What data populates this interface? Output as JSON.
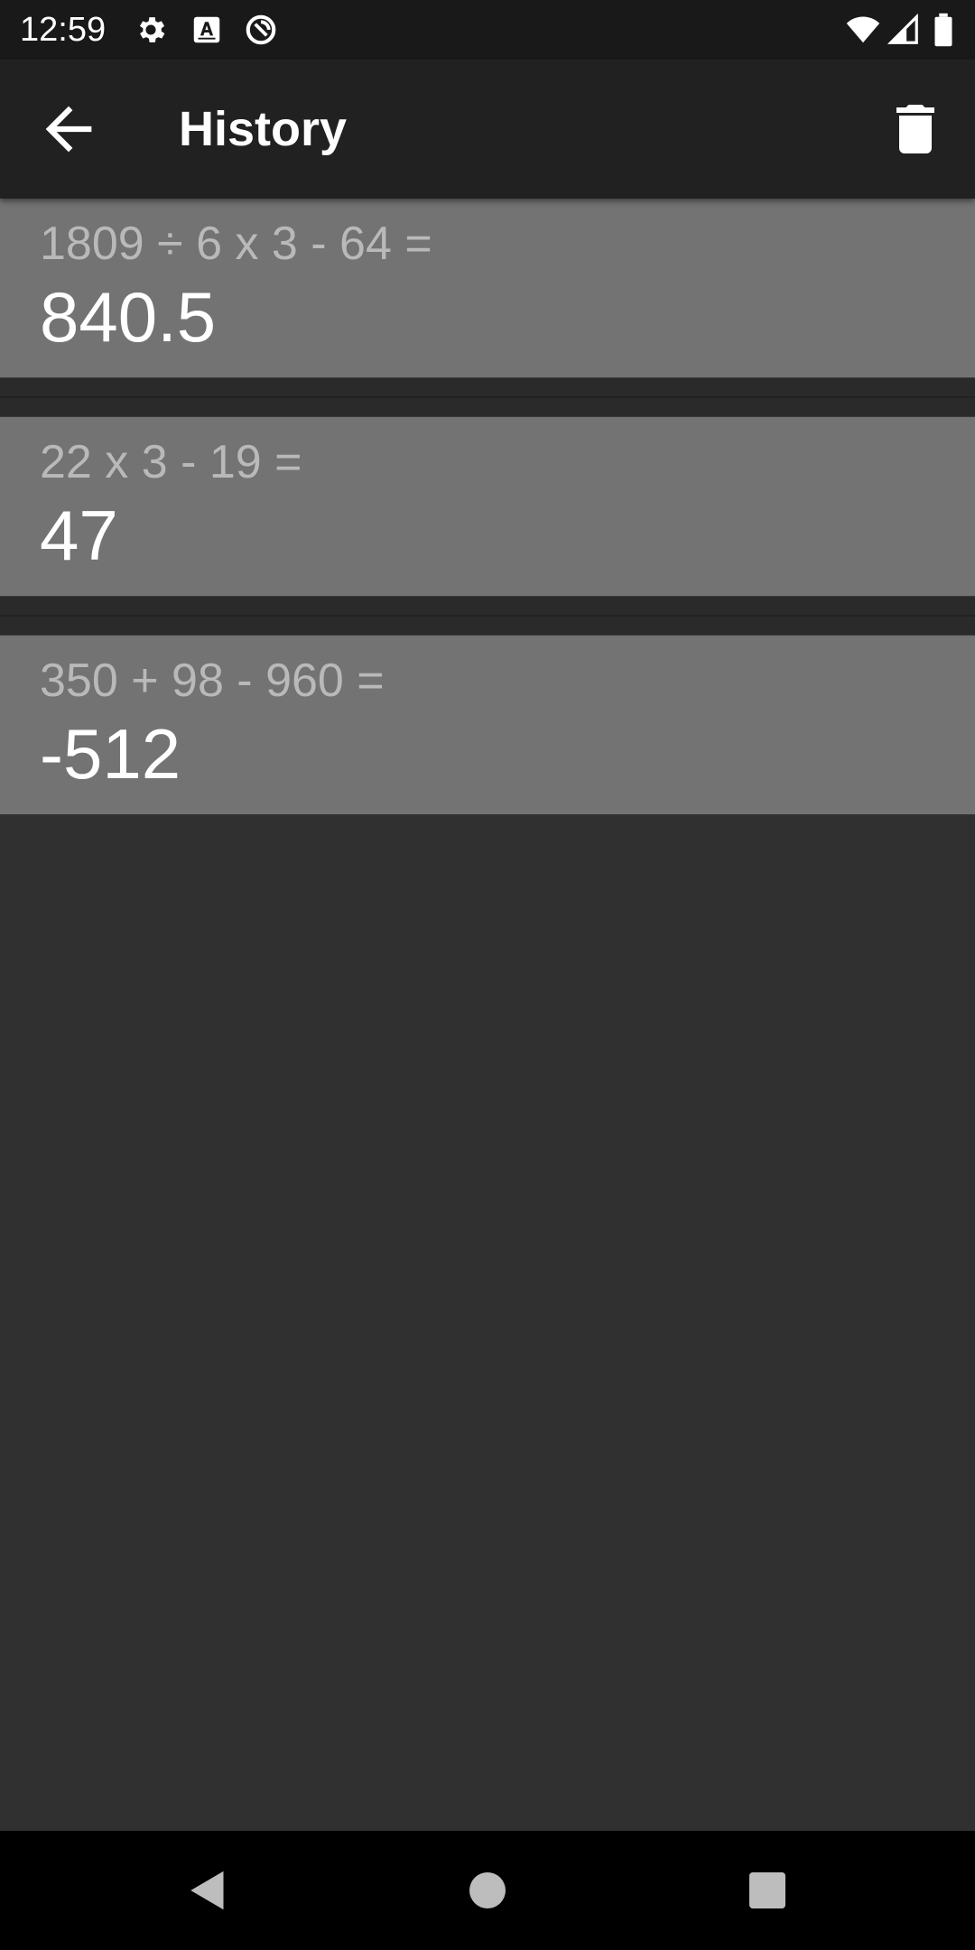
{
  "status_bar": {
    "time": "12:59",
    "icons": [
      "settings-icon",
      "keyboard-a-icon",
      "sync-badge-icon",
      "wifi-icon",
      "signal-icon",
      "battery-icon"
    ]
  },
  "app_bar": {
    "title": "History",
    "back_icon": "arrow-back-icon",
    "action_icon": "trash-icon"
  },
  "history": [
    {
      "expression": "1809 ÷ 6 x 3 - 64 =",
      "result": "840.5"
    },
    {
      "expression": "22 x 3 - 19 =",
      "result": "47"
    },
    {
      "expression": "350 + 98 - 960 =",
      "result": "-512"
    }
  ],
  "nav_bar": {
    "icons": [
      "back-triangle-icon",
      "home-circle-icon",
      "recents-square-icon"
    ]
  },
  "colors": {
    "status_bar_bg": "#191919",
    "app_bar_bg": "#212121",
    "background": "#303030",
    "item_bg": "#737373",
    "expression_text": "#b9b9b9",
    "result_text": "#ffffff",
    "nav_bar_bg": "#000000"
  }
}
